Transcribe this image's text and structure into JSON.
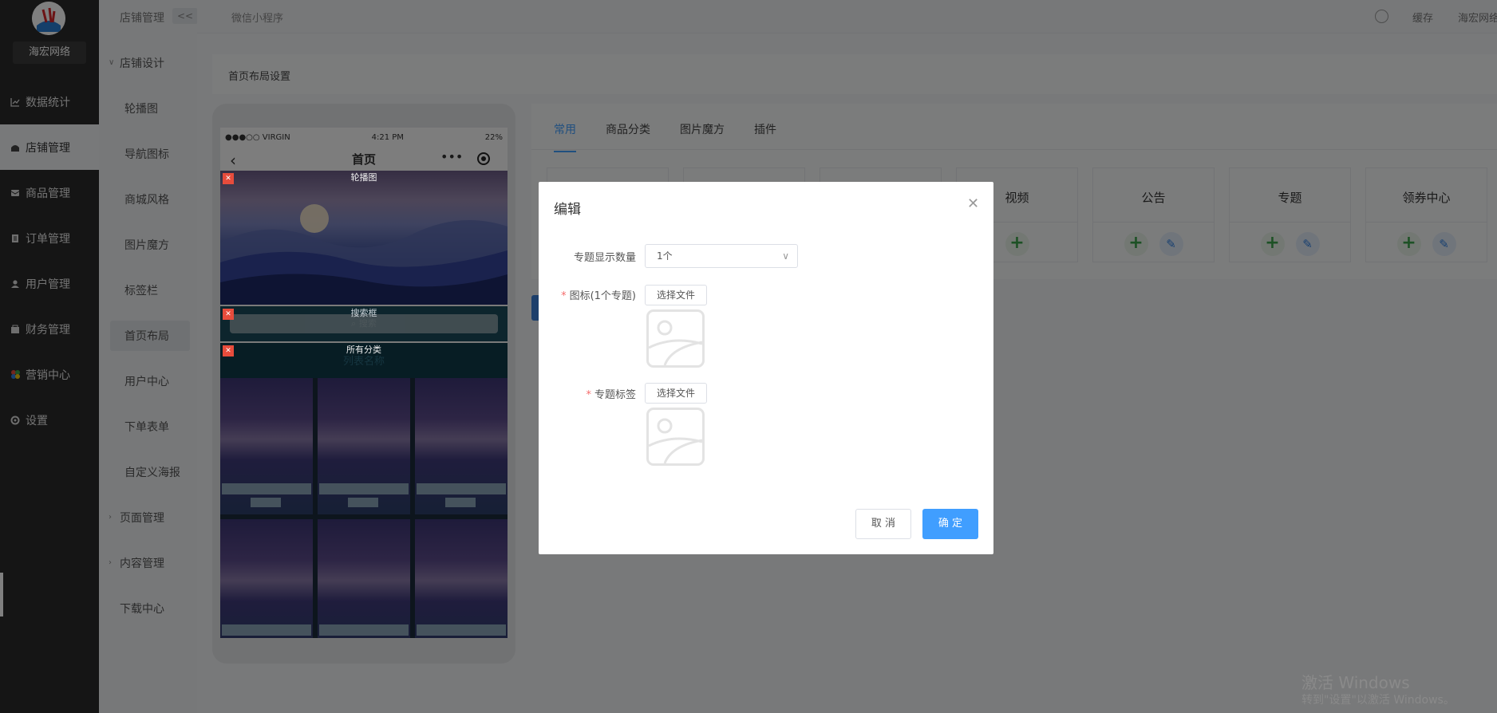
{
  "sidebar": {
    "brand": "海宏网络",
    "items": [
      {
        "label": "数据统计",
        "icon": "chart-icon"
      },
      {
        "label": "店铺管理",
        "icon": "store-icon"
      },
      {
        "label": "商品管理",
        "icon": "goods-icon"
      },
      {
        "label": "订单管理",
        "icon": "order-icon"
      },
      {
        "label": "用户管理",
        "icon": "user-icon"
      },
      {
        "label": "财务管理",
        "icon": "finance-icon"
      },
      {
        "label": "营销中心",
        "icon": "marketing-icon"
      },
      {
        "label": "设置",
        "icon": "settings-icon"
      }
    ]
  },
  "subsidebar": {
    "title": "店铺管理",
    "collapse": "<<",
    "group_design": "店铺设计",
    "design_items": [
      "轮播图",
      "导航图标",
      "商城风格",
      "图片魔方",
      "标签栏",
      "首页布局",
      "用户中心",
      "下单表单",
      "自定义海报"
    ],
    "group_page": "页面管理",
    "group_content": "内容管理",
    "download": "下载中心"
  },
  "topbar": {
    "title": "微信小程序",
    "save": "缓存",
    "user": "海宏网络"
  },
  "main": {
    "panel_title": "首页布局设置",
    "tabs": [
      "常用",
      "商品分类",
      "图片魔方",
      "插件"
    ],
    "cards": [
      "视频",
      "公告",
      "专题",
      "领券中心"
    ]
  },
  "phone": {
    "carrier": "●●●○○ VIRGIN",
    "time": "4:21 PM",
    "battery": "22%",
    "title": "首页",
    "banner_label": "轮播图",
    "search_label": "搜索框",
    "search_placeholder": "搜索",
    "category_label": "所有分类",
    "category_sub": "列表名称"
  },
  "modal": {
    "title": "编辑",
    "field_count_label": "专题显示数量",
    "field_count_value": "1个",
    "field_icon_label": "图标(1个专题)",
    "field_tag_label": "专题标签",
    "choose_file": "选择文件",
    "cancel": "取 消",
    "ok": "确 定"
  },
  "watermark": {
    "line1": "激活 Windows",
    "line2": "转到\"设置\"以激活 Windows。"
  },
  "colors": {
    "primary": "#409eff",
    "sidebar": "#2b2b2b",
    "danger": "#e74c3c"
  }
}
